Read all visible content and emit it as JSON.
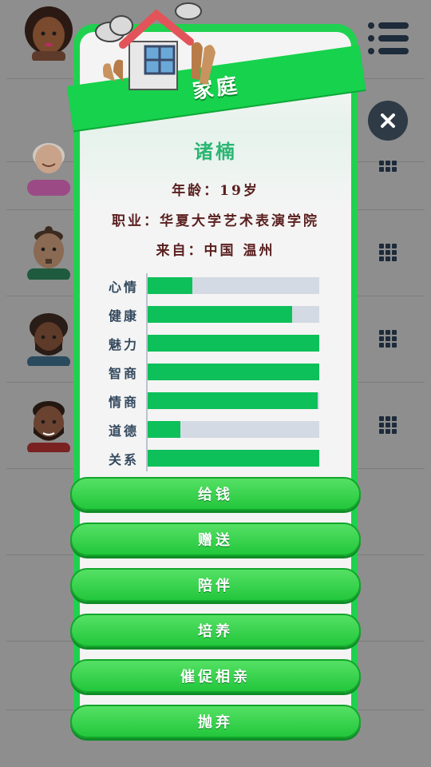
{
  "popup": {
    "title": "家庭",
    "name": "诸楠",
    "age_line": "年龄：19岁",
    "job_line": "职业：华夏大学艺术表演学院",
    "from_line": "来自：中国 温州"
  },
  "stats": [
    {
      "label": "心情",
      "value": 0.26
    },
    {
      "label": "健康",
      "value": 0.84
    },
    {
      "label": "魅力",
      "value": 1.0
    },
    {
      "label": "智商",
      "value": 1.0
    },
    {
      "label": "情商",
      "value": 0.99
    },
    {
      "label": "道德",
      "value": 0.19
    },
    {
      "label": "关系",
      "value": 1.0
    }
  ],
  "actions": [
    "给钱",
    "赠送",
    "陪伴",
    "培养",
    "催促相亲",
    "抛弃"
  ],
  "colors": {
    "accent_green": "#1fd14f",
    "bar_fill": "#0ec05a",
    "bar_track": "#d4dae3",
    "name_color": "#2bb673",
    "info_color": "#5a1f1f"
  },
  "icons": {
    "menu": "list-menu-icon",
    "close": "close-icon",
    "grid": "grid-dots-icon",
    "house": "house-icon"
  }
}
